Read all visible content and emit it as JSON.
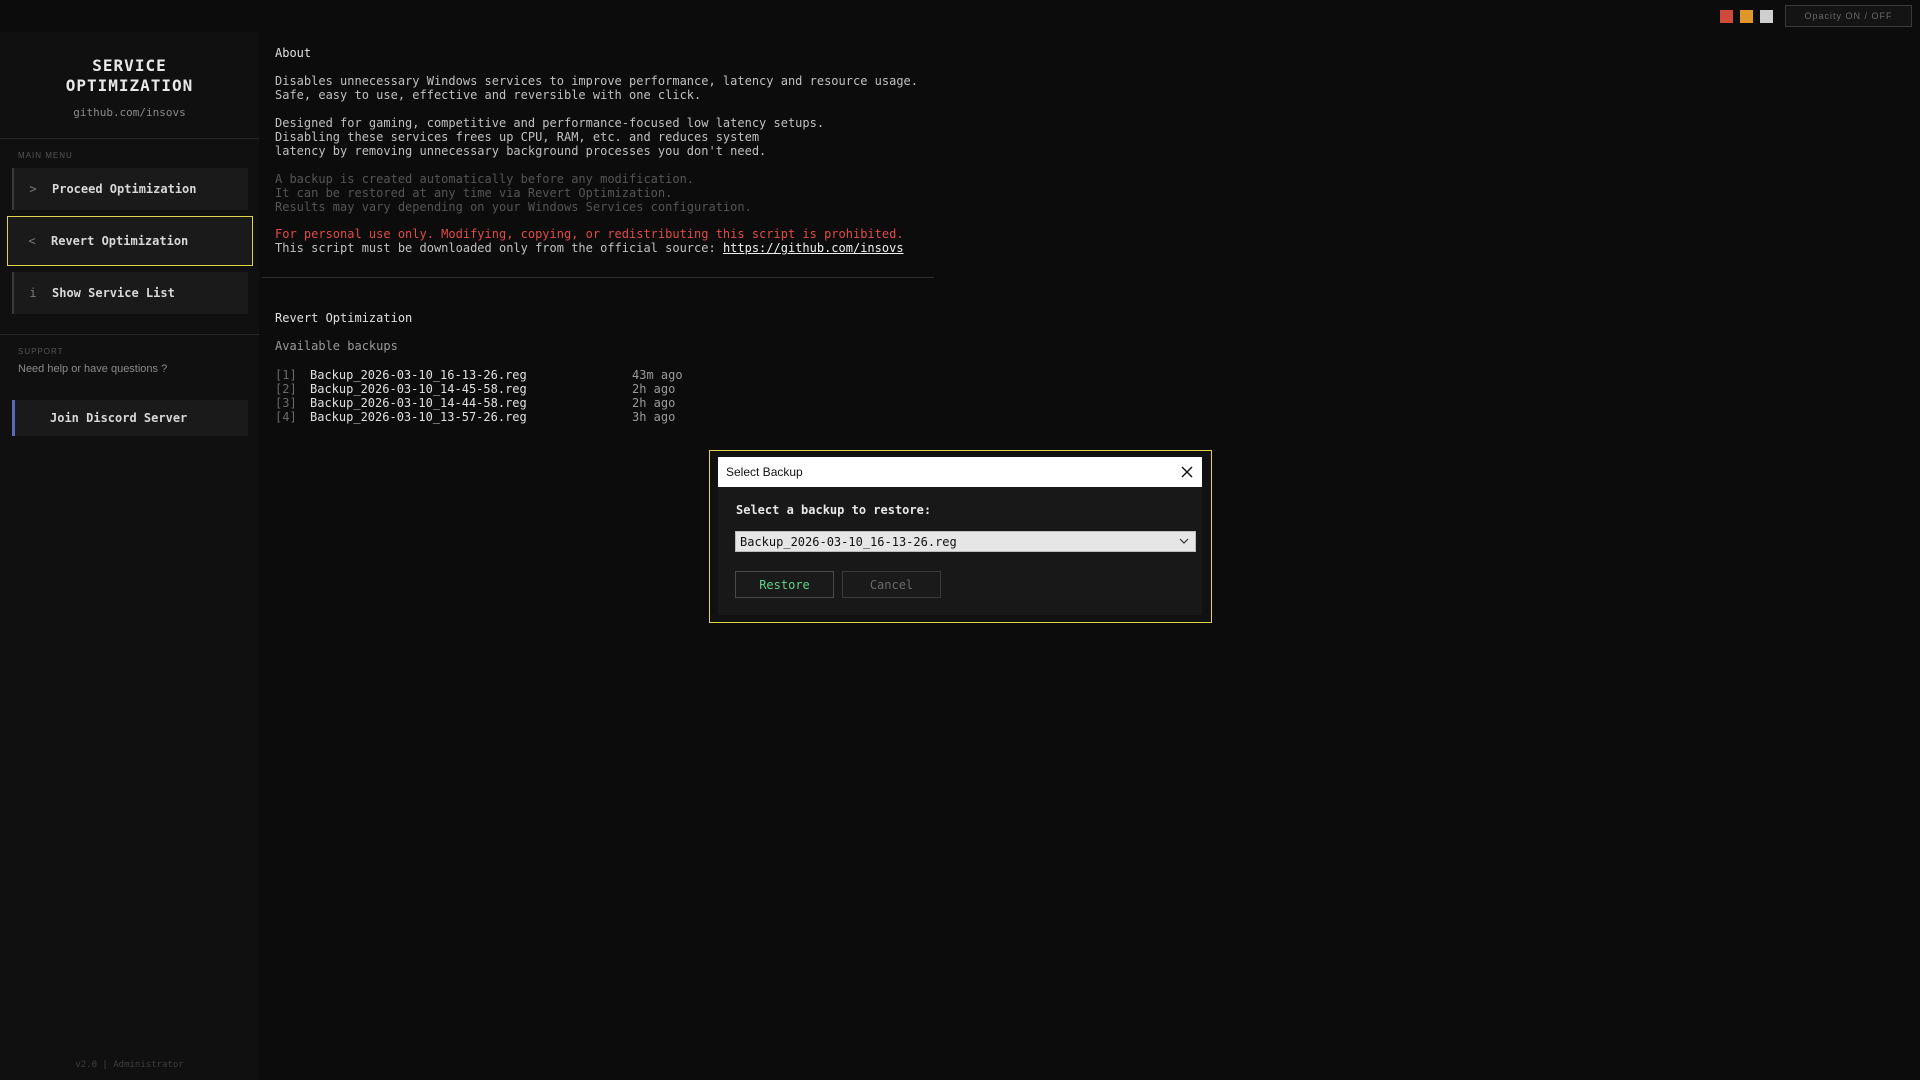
{
  "window": {
    "colors": {
      "red": "#d04a3c",
      "orange": "#e0962a",
      "white": "#cfcfcf",
      "accent": "#e3d34a"
    },
    "opacity_toggle_label": "Opacity  ON / OFF"
  },
  "sidebar": {
    "title_line1": "SERVICE",
    "title_line2": "OPTIMIZATION",
    "link": "github.com/insovs",
    "main_menu_label": "MAIN MENU",
    "items": [
      {
        "icon": "chevron-right-icon",
        "glyph": ">",
        "label": "Proceed Optimization"
      },
      {
        "icon": "chevron-left-icon",
        "glyph": "<",
        "label": "Revert Optimization",
        "active": true
      },
      {
        "icon": "info-icon",
        "glyph": "i",
        "label": "Show Service List"
      }
    ],
    "support_label": "SUPPORT",
    "support_text": "Need help or have questions ?",
    "discord_label": "Join Discord Server",
    "footer": "v2.0  |  Administrator"
  },
  "about": {
    "title": "About",
    "p1_l1": "Disables unnecessary Windows services to improve performance, latency and resource usage.",
    "p1_l2": "Safe, easy to use, effective and reversible with one click.",
    "p2_l1": "Designed for gaming, competitive and performance-focused low latency setups.",
    "p2_l2": "Disabling these services frees up CPU, RAM, etc. and reduces system",
    "p2_l3": "latency by removing unnecessary background processes you don't need.",
    "p3_l1": "A backup is created automatically before any modification.",
    "p3_l2": "It can be restored at any time via Revert Optimization.",
    "p3_l3": "Results may vary depending on your Windows Services configuration.",
    "warning": "For personal use only. Modifying, copying, or redistributing this script is prohibited.",
    "source_prefix": "This script must be downloaded only from the official source: ",
    "source_link": "https://github.com/insovs"
  },
  "revert": {
    "title": "Revert Optimization",
    "subtitle": "Available backups",
    "backups": [
      {
        "index": "[1]",
        "name": "Backup_2026-03-10_16-13-26.reg",
        "age": "43m ago"
      },
      {
        "index": "[2]",
        "name": "Backup_2026-03-10_14-45-58.reg",
        "age": "2h ago"
      },
      {
        "index": "[3]",
        "name": "Backup_2026-03-10_14-44-58.reg",
        "age": "2h ago"
      },
      {
        "index": "[4]",
        "name": "Backup_2026-03-10_13-57-26.reg",
        "age": "3h ago"
      }
    ]
  },
  "dialog": {
    "title": "Select Backup",
    "label": "Select a backup to restore:",
    "selected": "Backup_2026-03-10_16-13-26.reg",
    "restore_label": "Restore",
    "cancel_label": "Cancel"
  }
}
